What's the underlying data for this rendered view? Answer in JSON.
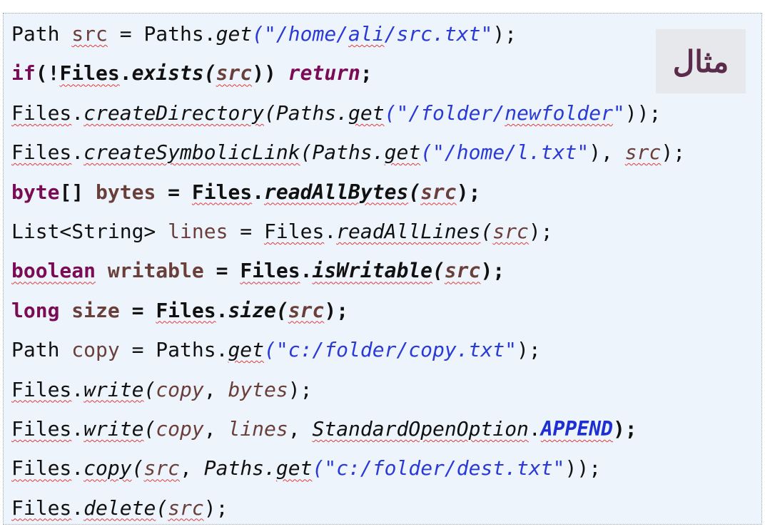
{
  "badge": {
    "label": "مثال"
  },
  "code": {
    "lines": [
      [
        {
          "t": "Path ",
          "c": ""
        },
        {
          "t": "src",
          "c": "var sq"
        },
        {
          "t": " = Paths.",
          "c": ""
        },
        {
          "t": "get",
          "c": "mth"
        },
        {
          "t": "(\"/home/",
          "c": "str"
        },
        {
          "t": "ali",
          "c": "str sq"
        },
        {
          "t": "/src.txt\"",
          "c": "str"
        },
        {
          "t": ");",
          "c": ""
        }
      ],
      [
        {
          "t": "if",
          "c": "kw"
        },
        {
          "t": "(!",
          "c": "b"
        },
        {
          "t": "Files",
          "c": "b sq"
        },
        {
          "t": ".",
          "c": "b"
        },
        {
          "t": "exists",
          "c": "b mth"
        },
        {
          "t": "(",
          "c": "b mth"
        },
        {
          "t": "src",
          "c": "var b mth sq"
        },
        {
          "t": ")) ",
          "c": "b"
        },
        {
          "t": "return",
          "c": "kw mth"
        },
        {
          "t": ";",
          "c": "b"
        }
      ],
      [
        {
          "t": "Files",
          "c": "sq"
        },
        {
          "t": ".",
          "c": ""
        },
        {
          "t": "createDirectory",
          "c": "mth sq"
        },
        {
          "t": "(Paths.",
          "c": "mth"
        },
        {
          "t": "get",
          "c": "mth sq"
        },
        {
          "t": "(\"/folder/",
          "c": "str"
        },
        {
          "t": "newfolder",
          "c": "str sq"
        },
        {
          "t": "\"",
          "c": "str"
        },
        {
          "t": "));",
          "c": ""
        }
      ],
      [
        {
          "t": "Files",
          "c": "sq"
        },
        {
          "t": ".",
          "c": ""
        },
        {
          "t": "createSymbolicLink",
          "c": "mth sq"
        },
        {
          "t": "(Paths.",
          "c": "mth"
        },
        {
          "t": "get",
          "c": "mth sq"
        },
        {
          "t": "(\"/home/l.txt\"",
          "c": "str"
        },
        {
          "t": "), ",
          "c": ""
        },
        {
          "t": "src",
          "c": "var mth sq"
        },
        {
          "t": ");",
          "c": ""
        }
      ],
      [
        {
          "t": "byte",
          "c": "kw"
        },
        {
          "t": "[] ",
          "c": "b"
        },
        {
          "t": "bytes",
          "c": "var b"
        },
        {
          "t": " = ",
          "c": "b"
        },
        {
          "t": "Files",
          "c": "b sq"
        },
        {
          "t": ".",
          "c": "b"
        },
        {
          "t": "readAllBytes",
          "c": "b mth sq"
        },
        {
          "t": "(",
          "c": "b mth"
        },
        {
          "t": "src",
          "c": "var b mth sq"
        },
        {
          "t": ");",
          "c": "b"
        }
      ],
      [
        {
          "t": "List<String> ",
          "c": ""
        },
        {
          "t": "lines",
          "c": "var"
        },
        {
          "t": " = ",
          "c": ""
        },
        {
          "t": "Files",
          "c": "sq"
        },
        {
          "t": ".",
          "c": ""
        },
        {
          "t": "readAllLines",
          "c": "mth sq"
        },
        {
          "t": "(",
          "c": "mth"
        },
        {
          "t": "src",
          "c": "var mth sq"
        },
        {
          "t": ");",
          "c": ""
        }
      ],
      [
        {
          "t": "boolean",
          "c": "kw sq"
        },
        {
          "t": " ",
          "c": ""
        },
        {
          "t": "writable",
          "c": "var b"
        },
        {
          "t": " = ",
          "c": "b"
        },
        {
          "t": "Files",
          "c": "b sq"
        },
        {
          "t": ".",
          "c": "b"
        },
        {
          "t": "isWritable",
          "c": "b mth sq"
        },
        {
          "t": "(",
          "c": "b mth"
        },
        {
          "t": "src",
          "c": "var b mth sq"
        },
        {
          "t": ");",
          "c": "b"
        }
      ],
      [
        {
          "t": "long",
          "c": "kw"
        },
        {
          "t": " ",
          "c": ""
        },
        {
          "t": "size",
          "c": "var b"
        },
        {
          "t": " = ",
          "c": "b"
        },
        {
          "t": "Files",
          "c": "b sq"
        },
        {
          "t": ".",
          "c": "b"
        },
        {
          "t": "size",
          "c": "b mth"
        },
        {
          "t": "(",
          "c": "b mth"
        },
        {
          "t": "src",
          "c": "var b mth sq"
        },
        {
          "t": ");",
          "c": "b"
        }
      ],
      [
        {
          "t": "Path ",
          "c": ""
        },
        {
          "t": "copy",
          "c": "var"
        },
        {
          "t": " = Paths.",
          "c": ""
        },
        {
          "t": "get",
          "c": "mth sq"
        },
        {
          "t": "(\"c:/folder/copy.txt\"",
          "c": "str"
        },
        {
          "t": ");",
          "c": ""
        }
      ],
      [
        {
          "t": "Files",
          "c": "sq"
        },
        {
          "t": ".",
          "c": ""
        },
        {
          "t": "write",
          "c": "mth sq"
        },
        {
          "t": "(",
          "c": "mth"
        },
        {
          "t": "copy",
          "c": "var mth"
        },
        {
          "t": ", ",
          "c": ""
        },
        {
          "t": "bytes",
          "c": "var mth"
        },
        {
          "t": ");",
          "c": ""
        }
      ],
      [
        {
          "t": "Files",
          "c": "sq"
        },
        {
          "t": ".",
          "c": ""
        },
        {
          "t": "write",
          "c": "mth sq"
        },
        {
          "t": "(",
          "c": "mth"
        },
        {
          "t": "copy",
          "c": "var mth"
        },
        {
          "t": ", ",
          "c": ""
        },
        {
          "t": "lines",
          "c": "var mth"
        },
        {
          "t": ", ",
          "c": ""
        },
        {
          "t": "StandardOpenOption",
          "c": "mth sq"
        },
        {
          "t": ".",
          "c": ""
        },
        {
          "t": "APPEND",
          "c": "cst sq"
        },
        {
          "t": ");",
          "c": "b"
        }
      ],
      [
        {
          "t": "Files",
          "c": "sq"
        },
        {
          "t": ".",
          "c": ""
        },
        {
          "t": "copy",
          "c": "mth sq"
        },
        {
          "t": "(",
          "c": "mth"
        },
        {
          "t": "src",
          "c": "var mth sq"
        },
        {
          "t": ", ",
          "c": ""
        },
        {
          "t": "Paths",
          "c": "mth"
        },
        {
          "t": ".",
          "c": "mth"
        },
        {
          "t": "get",
          "c": "mth sq"
        },
        {
          "t": "(\"c:/folder/dest.txt\"",
          "c": "str"
        },
        {
          "t": "));",
          "c": ""
        }
      ],
      [
        {
          "t": "Files",
          "c": "sq"
        },
        {
          "t": ".",
          "c": ""
        },
        {
          "t": "delete",
          "c": "mth sq"
        },
        {
          "t": "(",
          "c": "mth"
        },
        {
          "t": "src",
          "c": "var mth sq"
        },
        {
          "t": ");",
          "c": ""
        }
      ]
    ]
  }
}
